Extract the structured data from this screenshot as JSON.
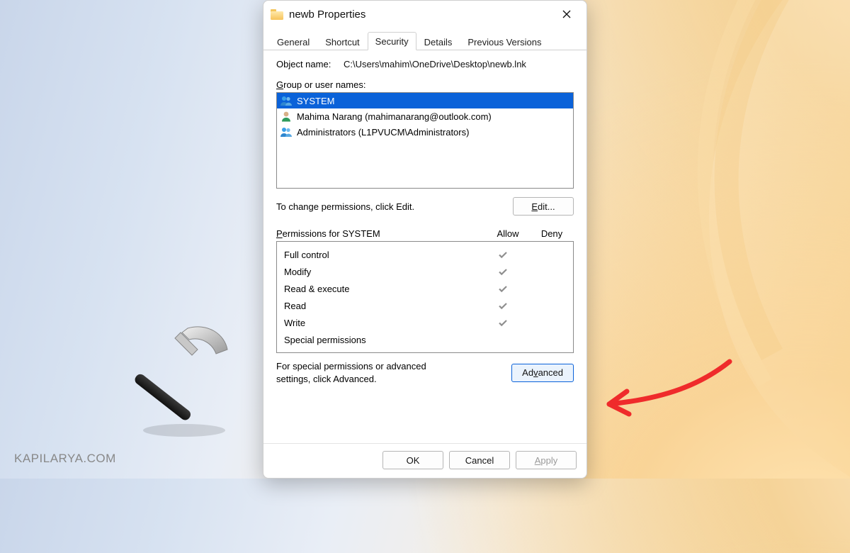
{
  "window": {
    "title": "newb Properties"
  },
  "tabs": {
    "items": [
      {
        "label": "General"
      },
      {
        "label": "Shortcut"
      },
      {
        "label": "Security"
      },
      {
        "label": "Details"
      },
      {
        "label": "Previous Versions"
      }
    ],
    "active_index": 2
  },
  "security": {
    "object_name_label": "Object name:",
    "object_name_value": "C:\\Users\\mahim\\OneDrive\\Desktop\\newb.lnk",
    "group_label_pre": "G",
    "group_label_post": "roup or user names:",
    "users": [
      {
        "label": "SYSTEM",
        "icon": "users-icon",
        "selected": true
      },
      {
        "label": "Mahima Narang (mahimanarang@outlook.com)",
        "icon": "user-icon",
        "selected": false
      },
      {
        "label": "Administrators (L1PVUCM\\Administrators)",
        "icon": "users-icon",
        "selected": false
      }
    ],
    "change_text": "To change permissions, click Edit.",
    "edit_button_pre": "E",
    "edit_button_post": "dit...",
    "perm_header_pre": "P",
    "perm_header_post": "ermissions for SYSTEM",
    "col_allow": "Allow",
    "col_deny": "Deny",
    "perms": [
      {
        "name": "Full control",
        "allow": true,
        "deny": false
      },
      {
        "name": "Modify",
        "allow": true,
        "deny": false
      },
      {
        "name": "Read & execute",
        "allow": true,
        "deny": false
      },
      {
        "name": "Read",
        "allow": true,
        "deny": false
      },
      {
        "name": "Write",
        "allow": true,
        "deny": false
      },
      {
        "name": "Special permissions",
        "allow": false,
        "deny": false
      }
    ],
    "advanced_text": "For special permissions or advanced settings, click Advanced.",
    "advanced_button_pre": "Ad",
    "advanced_button_mid": "v",
    "advanced_button_post": "anced"
  },
  "footer": {
    "ok": "OK",
    "cancel": "Cancel",
    "apply_pre": "A",
    "apply_post": "pply"
  },
  "watermark": "KAPILARYA.COM"
}
